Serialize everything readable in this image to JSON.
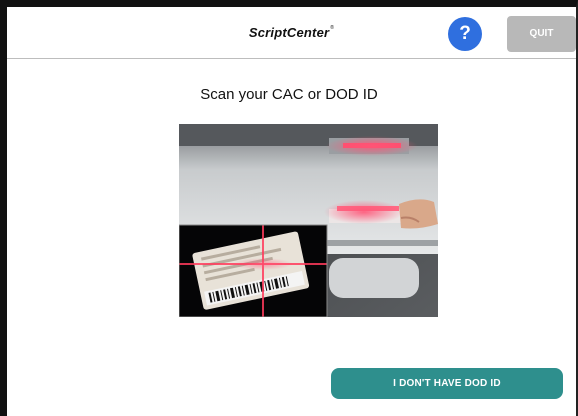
{
  "header": {
    "title": "ScriptCenter",
    "title_mark": "®",
    "help_label": "?",
    "quit_label": "QUIT"
  },
  "main": {
    "prompt": "Scan your CAC or DOD ID",
    "no_id_button_label": "I DON'T HAVE DOD ID"
  },
  "colors": {
    "help_button": "#2f6fdf",
    "quit_button": "#b8b8b8",
    "action_button": "#2e8f8d",
    "scanner_laser": "#ff3b5c"
  }
}
